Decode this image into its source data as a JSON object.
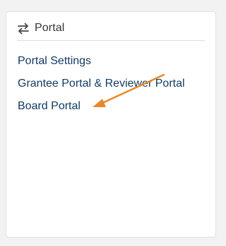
{
  "card": {
    "title": "Portal",
    "header_icon": "swap-arrows-icon"
  },
  "links": [
    {
      "label": "Portal Settings"
    },
    {
      "label": "Grantee Portal & Reviewer Portal"
    },
    {
      "label": "Board Portal"
    }
  ],
  "annotation": {
    "icon": "annotation-arrow-icon",
    "color": "#e8882a"
  },
  "colors": {
    "link": "#123b63",
    "title": "#333333",
    "background": "#f2f2f2",
    "card": "#ffffff"
  }
}
